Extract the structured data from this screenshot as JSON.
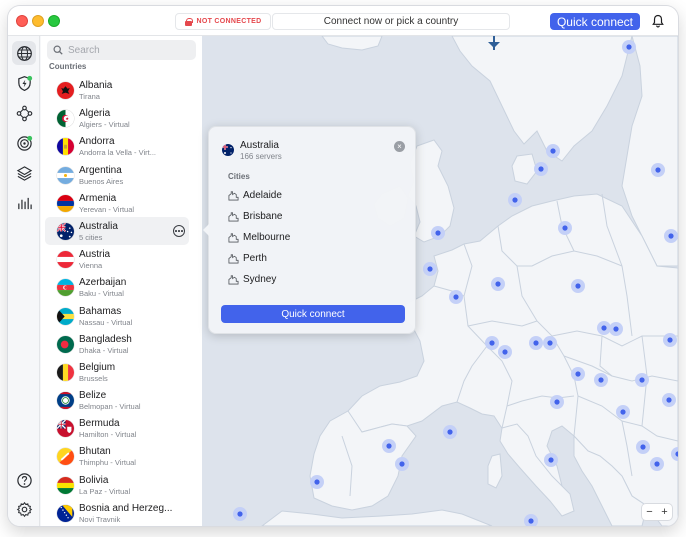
{
  "titlebar": {
    "status": "NOT CONNECTED",
    "center_text": "Connect now or pick a country",
    "quick_connect": "Quick connect"
  },
  "rail": {
    "items": [
      "globe-icon",
      "shield-bolt-icon",
      "meshnet-icon",
      "dark-web-monitor-icon",
      "layers-icon",
      "stats-icon"
    ],
    "bottom": [
      "help-icon",
      "settings-icon"
    ]
  },
  "sidebar": {
    "search_placeholder": "Search",
    "section_label": "Countries",
    "countries": [
      {
        "name": "Albania",
        "sub": "Tirana"
      },
      {
        "name": "Algeria",
        "sub": "Algiers - Virtual"
      },
      {
        "name": "Andorra",
        "sub": "Andorra la Vella - Virt..."
      },
      {
        "name": "Argentina",
        "sub": "Buenos Aires"
      },
      {
        "name": "Armenia",
        "sub": "Yerevan - Virtual"
      },
      {
        "name": "Australia",
        "sub": "5 cities"
      },
      {
        "name": "Austria",
        "sub": "Vienna"
      },
      {
        "name": "Azerbaijan",
        "sub": "Baku - Virtual"
      },
      {
        "name": "Bahamas",
        "sub": "Nassau - Virtual"
      },
      {
        "name": "Bangladesh",
        "sub": "Dhaka - Virtual"
      },
      {
        "name": "Belgium",
        "sub": "Brussels"
      },
      {
        "name": "Belize",
        "sub": "Belmopan - Virtual"
      },
      {
        "name": "Bermuda",
        "sub": "Hamilton - Virtual"
      },
      {
        "name": "Bhutan",
        "sub": "Thimphu - Virtual"
      },
      {
        "name": "Bolivia",
        "sub": "La Paz - Virtual"
      },
      {
        "name": "Bosnia and Herzeg...",
        "sub": "Novi Travnik"
      }
    ]
  },
  "popup": {
    "country": "Australia",
    "servers": "166 servers",
    "cities_label": "Cities",
    "cities": [
      "Adelaide",
      "Brisbane",
      "Melbourne",
      "Perth",
      "Sydney"
    ],
    "quick_connect": "Quick connect"
  },
  "map": {
    "zoom_out": "−",
    "zoom_in": "+"
  },
  "colors": {
    "accent": "#4263eb",
    "not_connected": "#e5484d",
    "map_water": "#dde3ec",
    "map_land": "#f3f5f8",
    "server_dot": "#4263eb"
  }
}
